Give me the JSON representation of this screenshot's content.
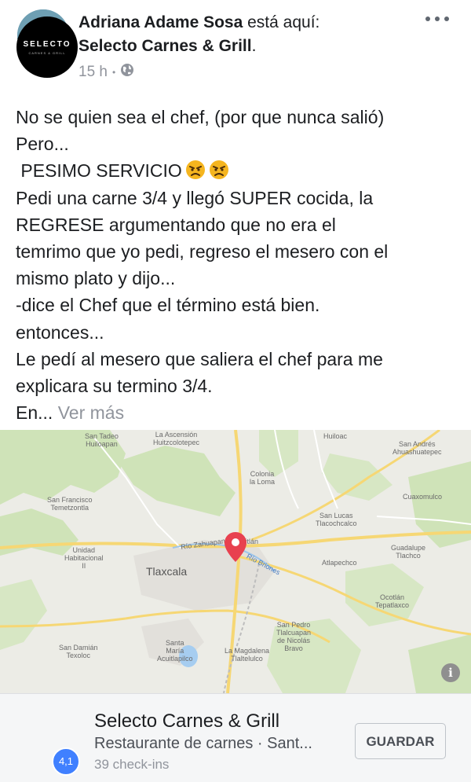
{
  "post": {
    "author": "Adriana Adame Sosa",
    "checkin_phrase": " está aquí:",
    "place_link": "Selecto Carnes & Grill",
    "place_link_suffix": ".",
    "time": "15 h",
    "privacy_icon": "globe-icon",
    "more_icon": "more-horizontal-icon",
    "lines": [
      "No se quien sea el chef, (por que nunca salió)",
      "Pero...",
      " PESIMO SERVICIO",
      "Pedi una carne 3/4 y llegó SUPER cocida, la",
      "REGRESE argumentando que no era el",
      "temrimo que yo pedi, regreso el mesero con el",
      "mismo plato y dijo...",
      "-dice el Chef que el término está bien.",
      "entonces...",
      "Le pedí al mesero que saliera el chef para me",
      "explicara su termino 3/4.",
      "En..."
    ],
    "see_more": "Ver más",
    "emojis": [
      "angry-face-icon",
      "angry-face-icon"
    ]
  },
  "map": {
    "labels": {
      "san_tadeo": "San Tadeo",
      "huiloapan": "Huiloapan",
      "la_ascension": "La Ascensión",
      "huitzcolotepec": "Huitzcolotepec",
      "huiloac": "Huiloac",
      "san_andres": "San Andrés",
      "ahuashuatepec": "Ahuashuatepec",
      "colonia": "Colonia",
      "la_loma": "la Loma",
      "san_francisco": "San Francisco",
      "temetzontla": "Temetzontla",
      "cuaxomulco": "Cuaxomulco",
      "san_lucas": "San Lucas",
      "tlacochcalco": "Tlacochcalco",
      "unidad": "Unidad",
      "habitacional": "Habitacional",
      "ii": "II",
      "rio_zahuapan": "Río Zahuapan",
      "rio_briones": "Río Briones",
      "guadalupe": "Guadalupe",
      "tlachco": "Tlachco",
      "atlapechco": "Atlapechco",
      "tlaxcala": "Tlaxcala",
      "ocotlan": "Ocotlán",
      "tepatlaxco": "Tepatlaxco",
      "ititlan": "titlán",
      "san_pedro": "San Pedro",
      "tlalcuapan": "Tlalcuapan",
      "de_nicolas": "de Nicolás",
      "bravo": "Bravo",
      "san_damian": "San Damián",
      "texoloc": "Texoloc",
      "santa": "Santa",
      "maria": "María",
      "acuitlapilco": "Acuitlapilco",
      "la_magdalena": "La Magdalena",
      "tlaltelulco": "Tlaltelulco"
    },
    "pin_icon": "map-pin-icon",
    "info_icon": "info-icon",
    "info_glyph": "i"
  },
  "place": {
    "logo_text": "SELECTO",
    "logo_sub": "CARNES & GRILL",
    "rating": "4,1",
    "name": "Selecto Carnes & Grill",
    "category": "Restaurante de carnes · Sant...",
    "checkins": "39 check-ins",
    "save_label": "GUARDAR"
  },
  "colors": {
    "link_text": "#1c1e21",
    "meta_gray": "#90949c",
    "rating_blue": "#4080ff",
    "pin_red": "#e8414f"
  }
}
